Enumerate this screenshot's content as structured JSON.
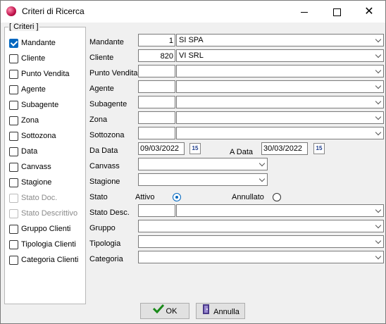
{
  "window": {
    "title": "Criteri di Ricerca"
  },
  "group_label": "[ Criteri ]",
  "checkboxes": [
    {
      "label": "Mandante",
      "checked": true,
      "disabled": false
    },
    {
      "label": "Cliente",
      "checked": false,
      "disabled": false
    },
    {
      "label": "Punto Vendita",
      "checked": false,
      "disabled": false
    },
    {
      "label": "Agente",
      "checked": false,
      "disabled": false
    },
    {
      "label": "Subagente",
      "checked": false,
      "disabled": false
    },
    {
      "label": "Zona",
      "checked": false,
      "disabled": false
    },
    {
      "label": "Sottozona",
      "checked": false,
      "disabled": false
    },
    {
      "label": "Data",
      "checked": false,
      "disabled": false
    },
    {
      "label": "Canvass",
      "checked": false,
      "disabled": false
    },
    {
      "label": "Stagione",
      "checked": false,
      "disabled": false
    },
    {
      "label": "Stato Doc.",
      "checked": false,
      "disabled": true
    },
    {
      "label": "Stato Descrittivo",
      "checked": false,
      "disabled": true
    },
    {
      "label": "Gruppo Clienti",
      "checked": false,
      "disabled": false
    },
    {
      "label": "Tipologia Clienti",
      "checked": false,
      "disabled": false
    },
    {
      "label": "Categoria Clienti",
      "checked": false,
      "disabled": false
    }
  ],
  "fields": {
    "mandante": {
      "label": "Mandante",
      "code": "1",
      "value": "SI              SPA"
    },
    "cliente": {
      "label": "Cliente",
      "code": "820",
      "value": "VI                      SRL"
    },
    "punto_vendita": {
      "label": "Punto Vendita",
      "code": "",
      "value": ""
    },
    "agente": {
      "label": "Agente",
      "code": "",
      "value": ""
    },
    "subagente": {
      "label": "Subagente",
      "code": "",
      "value": ""
    },
    "zona": {
      "label": "Zona",
      "code": "",
      "value": ""
    },
    "sottozona": {
      "label": "Sottozona",
      "code": "",
      "value": ""
    },
    "da_data": {
      "label": "Da Data",
      "value": "09/03/2022"
    },
    "a_data": {
      "label": "A Data",
      "value": "30/03/2022"
    },
    "calendar_icon_text": "15",
    "canvass": {
      "label": "Canvass",
      "value": ""
    },
    "stagione": {
      "label": "Stagione",
      "value": ""
    },
    "stato": {
      "label": "Stato",
      "option_attivo": "Attivo",
      "option_annullato": "Annullato",
      "selected": "Attivo"
    },
    "stato_desc": {
      "label": "Stato Desc.",
      "code": "",
      "value": ""
    },
    "gruppo": {
      "label": "Gruppo",
      "value": ""
    },
    "tipologia": {
      "label": "Tipologia",
      "value": ""
    },
    "categoria": {
      "label": "Categoria",
      "value": ""
    }
  },
  "buttons": {
    "ok": "OK",
    "annulla": "Annulla"
  }
}
